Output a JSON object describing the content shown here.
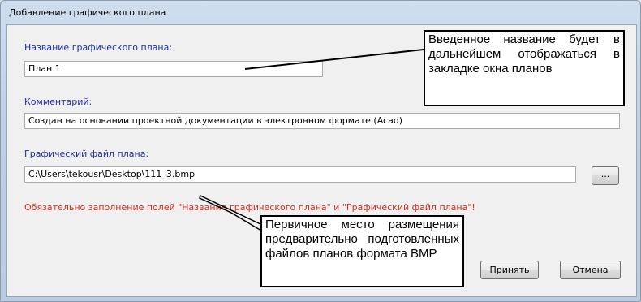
{
  "window": {
    "title": "Добавление графического плана"
  },
  "form": {
    "name_label": "Название графического плана:",
    "name_value": "План 1",
    "comment_label": "Комментарий:",
    "comment_value": "Создан на основании проектной документации в электронном формате (Acad)",
    "file_label": "Графический файл плана:",
    "file_value": "C:\\Users\\tekousr\\Desktop\\111_3.bmp",
    "browse_label": "...",
    "warning_text": "Обязательно заполнение полей \"Название графического плана\" и \"Графический файл плана\"!"
  },
  "buttons": {
    "accept_label": "Принять",
    "cancel_label": "Отмена"
  },
  "callouts": {
    "top_text": "Введенное название будет в дальнейшем отображаться в закладке окна планов",
    "bottom_text": "Первичное место размещения предварительно подготовленных файлов планов формата BMP"
  },
  "colors": {
    "label": "#1f2fa6",
    "warning": "#e0271c",
    "client_bg": "#f0f0f0"
  }
}
